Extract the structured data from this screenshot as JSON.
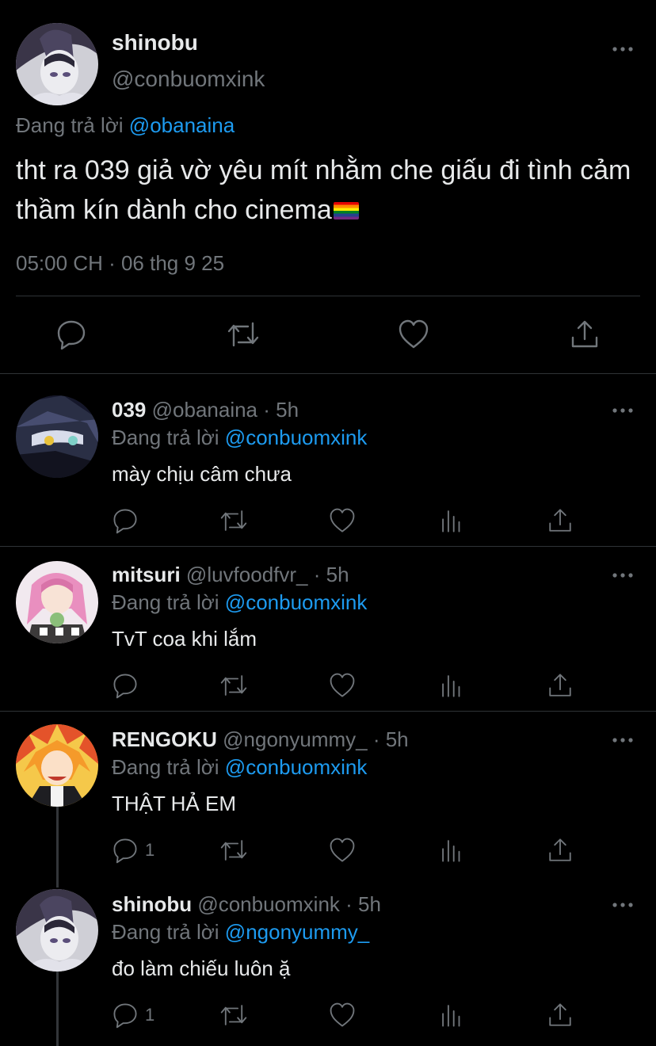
{
  "main_tweet": {
    "author_name": "shinobu",
    "author_handle": "@conbuomxink",
    "replying_prefix": "Đang trả lời",
    "replying_to": "@obanaina",
    "text": "tht ra 039 giả vờ yêu mít nhằm che giấu đi tình cảm thầm kín dành cho cinema",
    "text_emoji": "rainbow-flag",
    "timestamp": "05:00 CH · 06 thg 9 25",
    "actions": [
      "reply-icon",
      "retweet-icon",
      "like-icon",
      "share-icon"
    ]
  },
  "replies": [
    {
      "name": "039",
      "handle": "@obanaina · 5h",
      "replying_prefix": "Đang trả lời",
      "replying_to": "@conbuomxink",
      "text": "mày chịu câm chưa",
      "reply_count": ""
    },
    {
      "name": "mitsuri",
      "handle": "@luvfoodfvr_ · 5h",
      "replying_prefix": "Đang trả lời",
      "replying_to": "@conbuomxink",
      "text": "TvT coa khi lắm",
      "reply_count": ""
    },
    {
      "name": "RENGOKU",
      "handle": "@ngonyummy_ · 5h",
      "replying_prefix": "Đang trả lời",
      "replying_to": "@conbuomxink",
      "text": "THẬT HẢ EM",
      "reply_count": "1"
    },
    {
      "name": "shinobu",
      "handle": "@conbuomxink · 5h",
      "replying_prefix": "Đang trả lời",
      "replying_to": "@ngonyummy_",
      "text": "đo làm chiếu luôn ặ",
      "reply_count": "1"
    }
  ],
  "colors": {
    "background": "#000000",
    "text_primary": "#e7e9ea",
    "text_secondary": "#71767b",
    "link": "#1d9bf0",
    "divider": "#2f3336"
  }
}
